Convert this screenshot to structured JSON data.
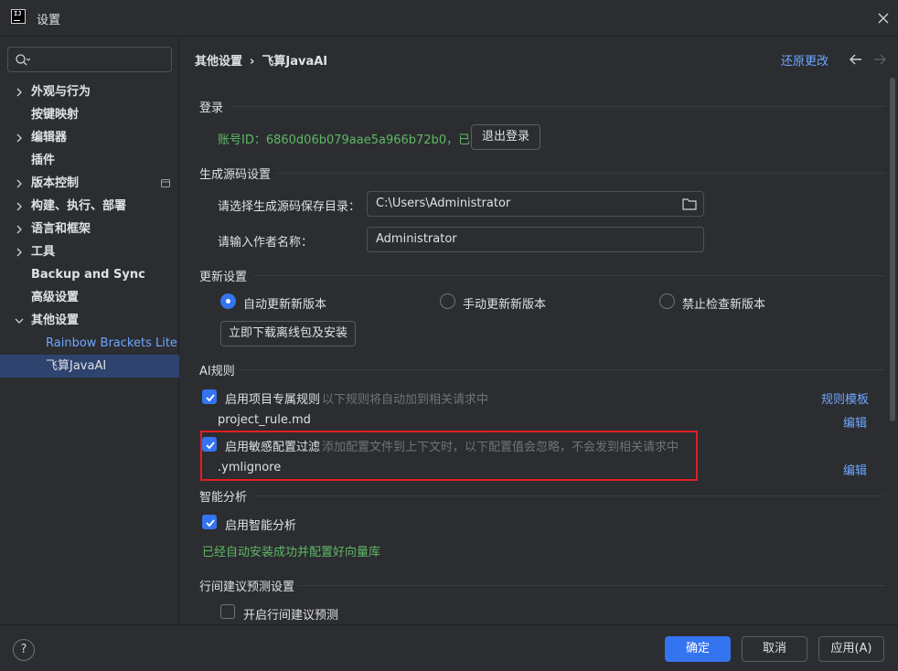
{
  "window": {
    "title": "设置",
    "icon": "intellij-app-icon"
  },
  "sidebar": {
    "search": {
      "placeholder": "",
      "icon": "search-icon"
    },
    "items": [
      {
        "label": "外观与行为",
        "arrow": "chevron-right"
      },
      {
        "label": "按键映射"
      },
      {
        "label": "编辑器",
        "arrow": "chevron-right"
      },
      {
        "label": "插件"
      },
      {
        "label": "版本控制",
        "arrow": "chevron-right"
      },
      {
        "label": "构建、执行、部署",
        "arrow": "chevron-right"
      },
      {
        "label": "语言和框架",
        "arrow": "chevron-right"
      },
      {
        "label": "工具",
        "arrow": "chevron-right"
      },
      {
        "label": "Backup and Sync"
      },
      {
        "label": "高级设置"
      },
      {
        "label": "其他设置",
        "arrow": "chevron-down"
      },
      {
        "label": "Rainbow Brackets Lite"
      },
      {
        "label": "飞算JavaAI"
      }
    ]
  },
  "header": {
    "breadcrumb": [
      "其他设置",
      "飞算JavaAI"
    ],
    "breadcrumb_sep": "›",
    "revert_label": "还原更改"
  },
  "login": {
    "title": "登录",
    "account_text": "账号ID：6860d06b079aae5a966b72b0，已登录",
    "logout_label": "退出登录"
  },
  "codegen": {
    "title": "生成源码设置",
    "dir_label": "请选择生成源码保存目录：",
    "dir_value": "C:\\Users\\Administrator",
    "author_label": "请输入作者名称：",
    "author_value": "Administrator"
  },
  "update": {
    "title": "更新设置",
    "options": [
      {
        "label": "自动更新新版本",
        "selected": true
      },
      {
        "label": "手动更新新版本",
        "selected": false
      },
      {
        "label": "禁止检查新版本",
        "selected": false
      }
    ],
    "download_label": "立即下载离线包及安装"
  },
  "ai_rules": {
    "title": "AI规则",
    "project_rule": {
      "label": "启用项目专属规则",
      "hint": "以下规则将自动加到相关请求中",
      "checked": true,
      "template_link": "规则模板",
      "file": "project_rule.md",
      "edit": "编辑"
    },
    "sensitive": {
      "label": "启用敏感配置过滤",
      "hint": "添加配置文件到上下文时，以下配置值会忽略，不会发到相关请求中",
      "checked": true,
      "file": ".ymlignore",
      "edit": "编辑"
    }
  },
  "smart": {
    "title": "智能分析",
    "label": "启用智能分析",
    "checked": true,
    "status": "已经自动安装成功并配置好向量库"
  },
  "inline": {
    "title": "行间建议预测设置",
    "label": "开启行间建议预测",
    "checked": false
  },
  "footer": {
    "help": "?",
    "ok": "确定",
    "cancel": "取消",
    "apply": "应用(A)"
  },
  "colors": {
    "accent": "#3574f0",
    "link": "#6fa6ff",
    "success": "#5fb865",
    "highlight": "#e01f23"
  }
}
